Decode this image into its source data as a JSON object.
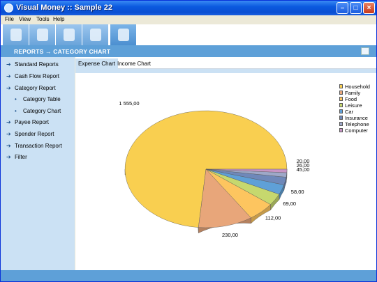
{
  "window": {
    "title": "Visual Money :: Sample 22"
  },
  "menu": [
    {
      "label": "File"
    },
    {
      "label": "View"
    },
    {
      "label": "Tools"
    },
    {
      "label": "Help"
    }
  ],
  "toolbar": {
    "buttons": [
      {
        "icon": "user-icon"
      },
      {
        "icon": "account-icon"
      },
      {
        "icon": "transfer-icon"
      },
      {
        "icon": "group-icon"
      },
      {
        "icon": "report-icon",
        "active": true
      }
    ]
  },
  "header": {
    "breadcrumb": "REPORTS → CATEGORY CHART",
    "print_icon": "printer-icon"
  },
  "sidebar": {
    "items": [
      {
        "label": "Standard Reports",
        "sub": false
      },
      {
        "label": "Cash Flow Report",
        "sub": false
      },
      {
        "label": "Category Report",
        "sub": false
      },
      {
        "label": "Category Table",
        "sub": true
      },
      {
        "label": "Category Chart",
        "sub": true
      },
      {
        "label": "Payee Report",
        "sub": false
      },
      {
        "label": "Spender Report",
        "sub": false
      },
      {
        "label": "Transaction Report",
        "sub": false
      },
      {
        "label": "Filter",
        "sub": false
      }
    ]
  },
  "tabs": [
    {
      "label": "Expense Chart",
      "active": true
    },
    {
      "label": "Income Chart",
      "active": false
    }
  ],
  "colors": {
    "accent": "#5ea0d8",
    "sidebar": "#cbe1f4"
  },
  "chart_data": {
    "type": "pie",
    "categories": [
      "Household",
      "Family",
      "Food",
      "Leisure",
      "Car",
      "Insurance",
      "Telephone",
      "Computer"
    ],
    "values": [
      1555,
      230,
      112,
      69,
      58,
      45,
      26,
      20
    ],
    "value_labels": [
      "1 555,00",
      "230,00",
      "112,00",
      "69,00",
      "58,00",
      "45,00",
      "26,00",
      "20,00"
    ],
    "colors": [
      "#f9cf50",
      "#e8a67a",
      "#fdc55f",
      "#c6d86e",
      "#5fa0d7",
      "#6f88b9",
      "#9ea8c8",
      "#c895c5"
    ],
    "legend": "top-right"
  }
}
